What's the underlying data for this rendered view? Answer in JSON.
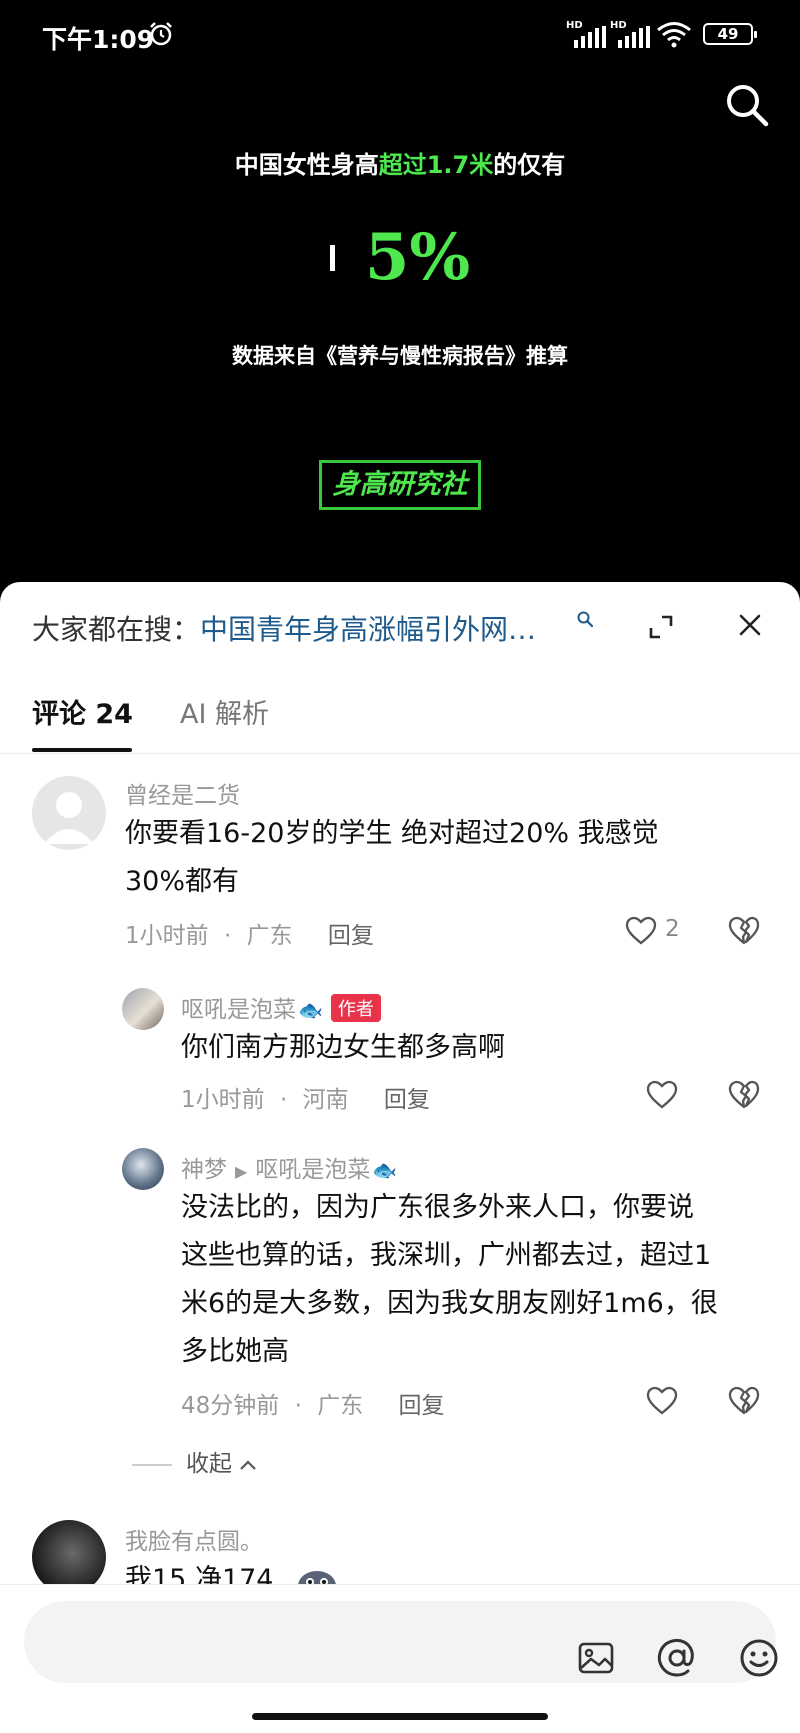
{
  "status_bar": {
    "time": "下午1:09",
    "battery": "49",
    "signal_label_1": "HD",
    "signal_label_2": "HD"
  },
  "video": {
    "headline_prefix": "中国女性身高",
    "headline_highlight": "超过1.7米",
    "headline_suffix": "的仅有",
    "big_stat": "5%",
    "source": "数据来自《营养与慢性病报告》推算",
    "brand": "身高研究社"
  },
  "sheet": {
    "search_label": "大家都在搜：",
    "search_term": "中国青年身高涨幅引外网…",
    "tabs": [
      {
        "label": "评论 24"
      },
      {
        "label": "AI 解析"
      }
    ]
  },
  "comments": [
    {
      "author": "曾经是二货",
      "body_line1": "你要看16-20岁的学生 绝对超过20% 我感觉",
      "body_line2": "30%都有",
      "time": "1小时前",
      "location": "广东",
      "reply": "回复",
      "likes": "2"
    },
    {
      "author": "呕吼是泡菜",
      "author_tag": "作者",
      "body_line1": "你们南方那边女生都多高啊",
      "time": "1小时前",
      "location": "河南",
      "reply": "回复"
    },
    {
      "author": "神梦",
      "reply_to": "呕吼是泡菜",
      "body_line1": "没法比的，因为广东很多外来人口，你要说",
      "body_line2": "这些也算的话，我深圳，广州都去过，超过1",
      "body_line3": "米6的是大多数，因为我女朋友刚好1m6，很",
      "body_line4": "多比她高",
      "time": "48分钟前",
      "location": "广东",
      "reply": "回复"
    },
    {
      "author": "我脸有点圆。",
      "body_line1": "我15 净174"
    }
  ],
  "collapse_label": "收起",
  "meta_separator": "·",
  "input": {
    "placeholder": ""
  },
  "colors": {
    "accent_green": "#4ee84e",
    "link_blue": "#1f5a8c",
    "author_tag": "#e8334a"
  }
}
